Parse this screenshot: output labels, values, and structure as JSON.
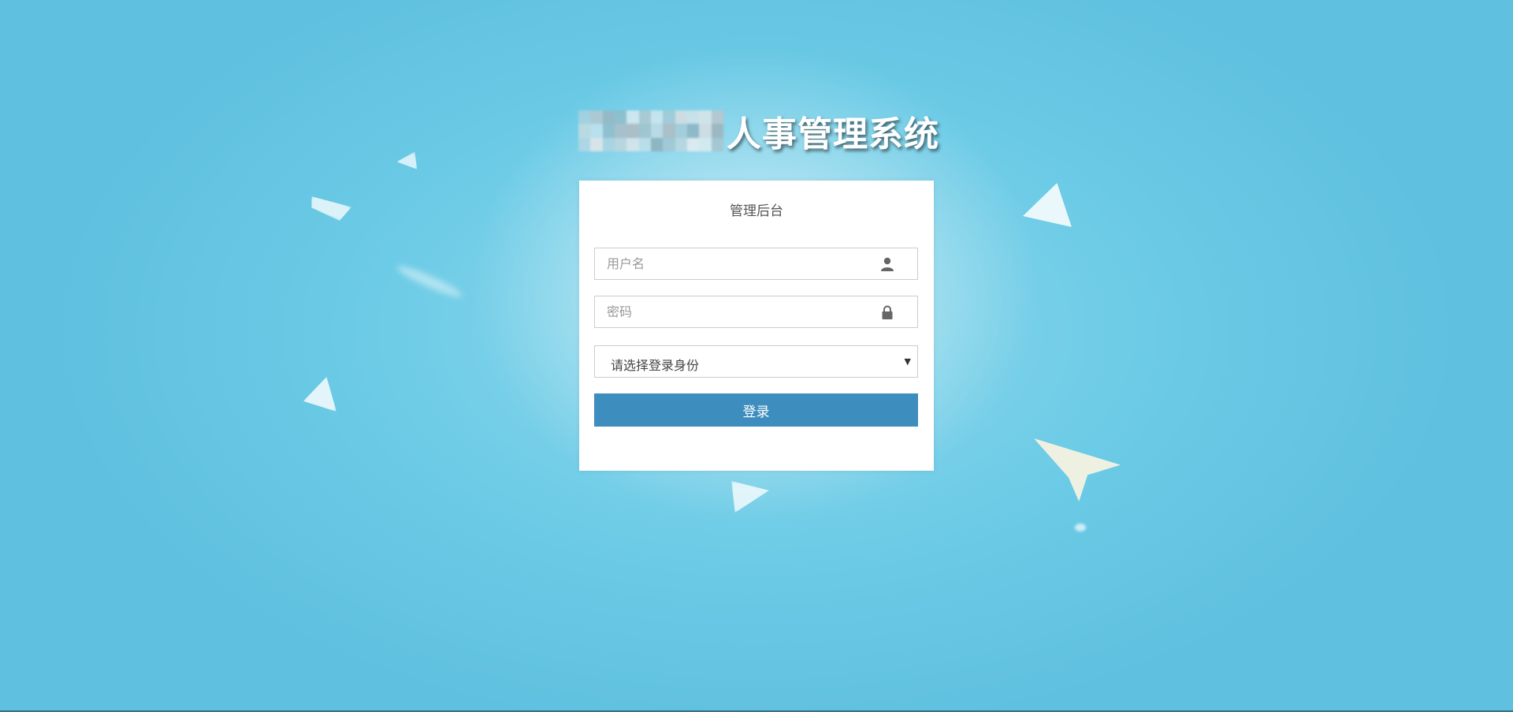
{
  "header": {
    "title_suffix": "人事管理系统"
  },
  "login": {
    "panel_title": "管理后台",
    "username_placeholder": "用户名",
    "password_placeholder": "密码",
    "role_select_value": "请选择登录身份",
    "submit_label": "登录"
  },
  "colors": {
    "background": "#6ccbe6",
    "button": "#3d8dbf",
    "panel": "#ffffff"
  },
  "icons": {
    "username": "user-icon",
    "password": "lock-icon",
    "select": "caret-down-icon"
  }
}
